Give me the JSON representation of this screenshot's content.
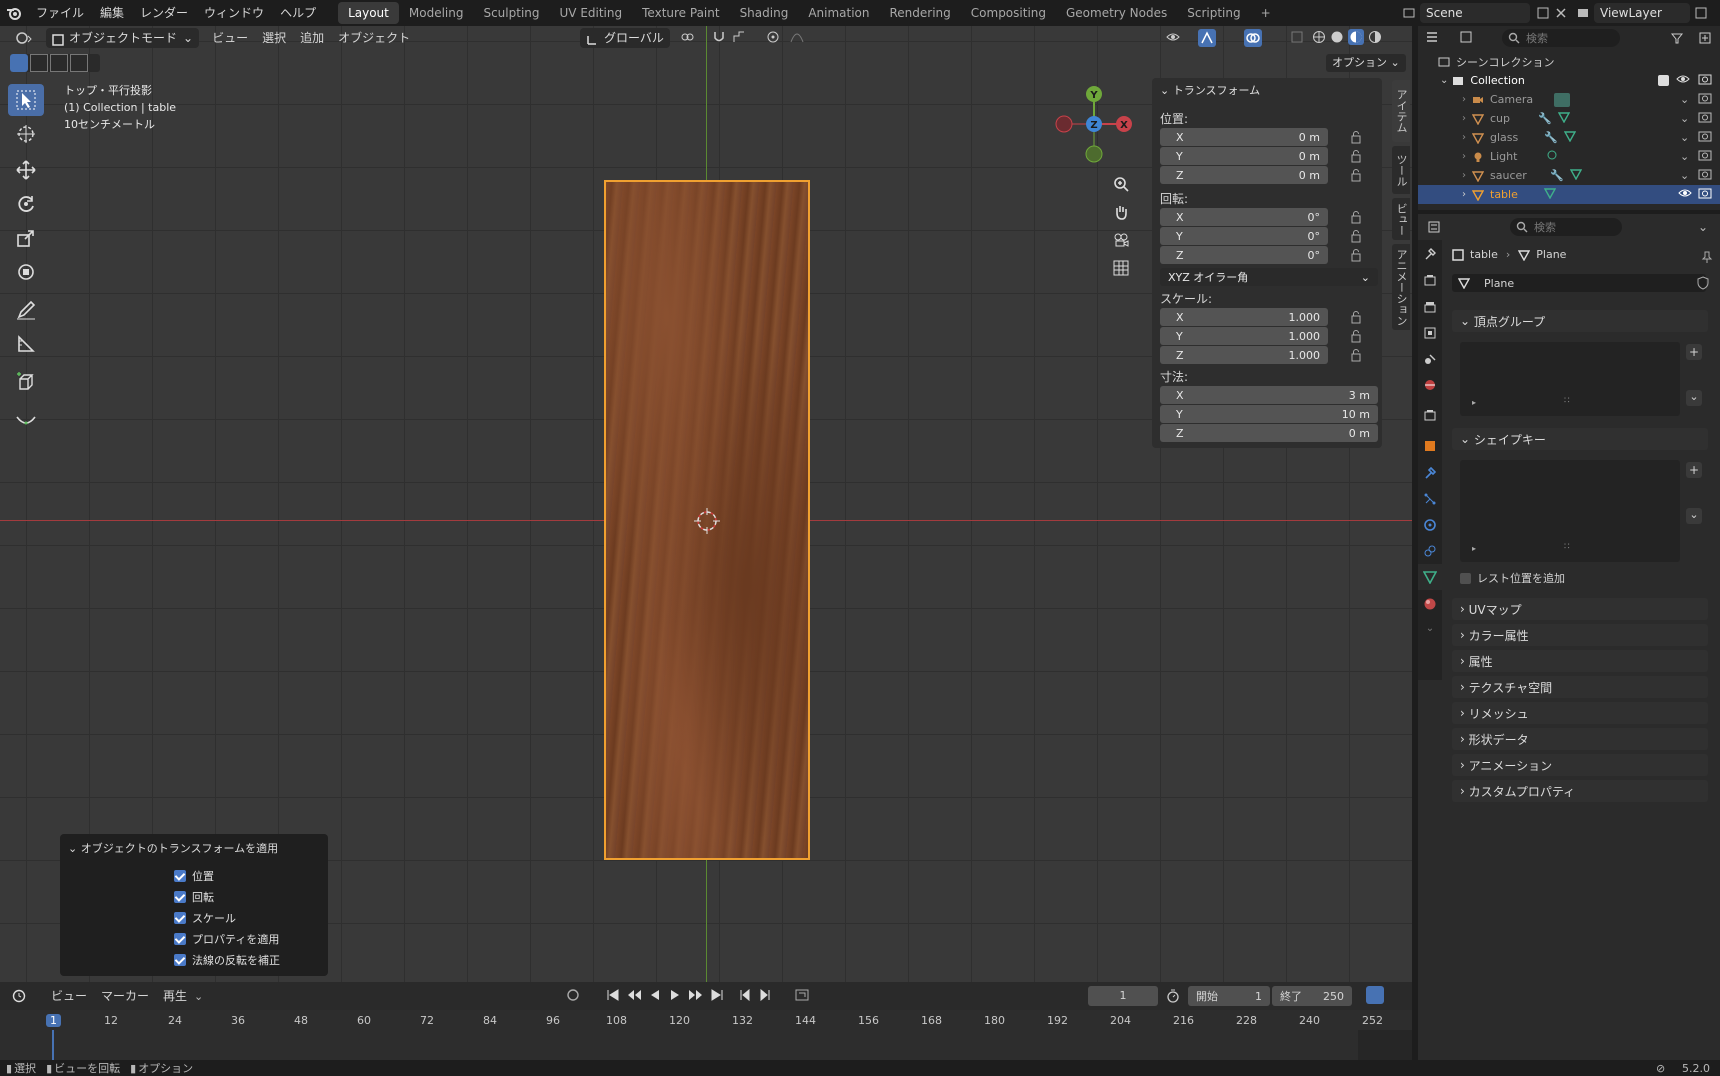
{
  "topbar": {
    "menus": [
      "ファイル",
      "編集",
      "レンダー",
      "ウィンドウ",
      "ヘルプ"
    ],
    "workspaces": [
      "Layout",
      "Modeling",
      "Sculpting",
      "UV Editing",
      "Texture Paint",
      "Shading",
      "Animation",
      "Rendering",
      "Compositing",
      "Geometry Nodes",
      "Scripting"
    ],
    "active_workspace": "Layout",
    "add_workspace": "+",
    "scene": "Scene",
    "view_layer": "ViewLayer"
  },
  "viewport_header": {
    "mode": "オブジェクトモード",
    "menus": [
      "ビュー",
      "選択",
      "追加",
      "オブジェクト"
    ],
    "orientation": "グローバル",
    "options": "オプション"
  },
  "overlay_text": {
    "view_name": "トップ・平行投影",
    "collection_line": "(1) Collection | table",
    "scale_line": "10センチメートル"
  },
  "gizmo": {
    "x": "X",
    "y": "Y",
    "z": "Z"
  },
  "npanel": {
    "title": "トランスフォーム",
    "location_label": "位置:",
    "location": [
      {
        "axis": "X",
        "value": "0 m"
      },
      {
        "axis": "Y",
        "value": "0 m"
      },
      {
        "axis": "Z",
        "value": "0 m"
      }
    ],
    "rotation_label": "回転:",
    "rotation": [
      {
        "axis": "X",
        "value": "0°"
      },
      {
        "axis": "Y",
        "value": "0°"
      },
      {
        "axis": "Z",
        "value": "0°"
      }
    ],
    "rotation_mode": "XYZ オイラー角",
    "scale_label": "スケール:",
    "scale": [
      {
        "axis": "X",
        "value": "1.000"
      },
      {
        "axis": "Y",
        "value": "1.000"
      },
      {
        "axis": "Z",
        "value": "1.000"
      }
    ],
    "dimensions_label": "寸法:",
    "dimensions": [
      {
        "axis": "X",
        "value": "3 m"
      },
      {
        "axis": "Y",
        "value": "10 m"
      },
      {
        "axis": "Z",
        "value": "0 m"
      }
    ]
  },
  "side_tabs": [
    "アイテム",
    "ツール",
    "ビュー",
    "アニメーション"
  ],
  "operator_panel": {
    "title": "オブジェクトのトランスフォームを適用",
    "options": [
      "位置",
      "回転",
      "スケール",
      "プロパティを適用",
      "法線の反転を補正"
    ]
  },
  "outliner": {
    "search_placeholder": "検索",
    "root": "シーンコレクション",
    "collection": "Collection",
    "objects": [
      "Camera",
      "cup",
      "glass",
      "Light",
      "saucer",
      "table"
    ],
    "selected": "table"
  },
  "properties": {
    "search_placeholder": "検索",
    "breadcrumb_object": "table",
    "breadcrumb_data": "Plane",
    "mesh_name": "Plane",
    "vertex_groups": "頂点グループ",
    "shape_keys": "シェイプキー",
    "add_rest_position": "レスト位置を追加",
    "collapsed_sections": [
      "UVマップ",
      "カラー属性",
      "属性",
      "テクスチャ空間",
      "リメッシュ",
      "形状データ",
      "アニメーション",
      "カスタムプロパティ"
    ]
  },
  "timeline": {
    "menus": [
      "ビュー",
      "マーカー",
      "再生"
    ],
    "current_frame": "1",
    "start_label": "開始",
    "start": "1",
    "end_label": "終了",
    "end": "250",
    "ticks": [
      "1",
      "12",
      "24",
      "36",
      "48",
      "60",
      "72",
      "84",
      "96",
      "108",
      "120",
      "132",
      "144",
      "156",
      "168",
      "180",
      "192",
      "204",
      "216",
      "228",
      "240",
      "252"
    ]
  },
  "statusbar": {
    "items": [
      "選択",
      "ビューを回転",
      "オプション"
    ],
    "version": "5.2.0"
  },
  "colors": {
    "accent": "#4772b3",
    "selection_orange": "#f0a030",
    "wood": "#7a4426",
    "x_axis": "#c8424a",
    "y_axis": "#6fa83a",
    "z_axis": "#3f86d6"
  }
}
